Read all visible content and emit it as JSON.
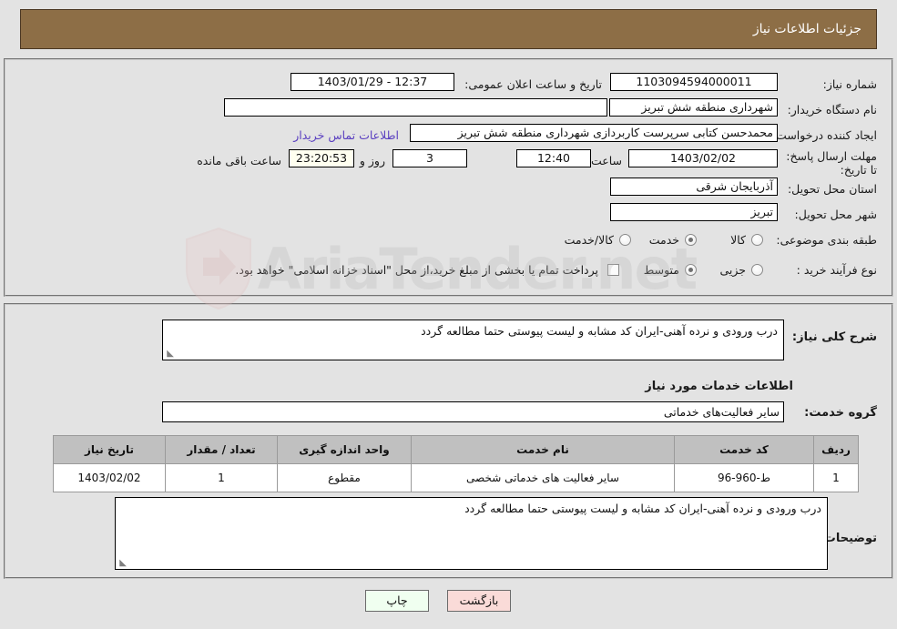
{
  "header": {
    "title": "جزئیات اطلاعات نیاز"
  },
  "form": {
    "need_number_label": "شماره نیاز:",
    "need_number_value": "1103094594000011",
    "announce_datetime_label": "تاریخ و ساعت اعلان عمومی:",
    "announce_datetime_value": "12:37 - 1403/01/29",
    "buyer_org_label": "نام دستگاه خریدار:",
    "buyer_org_value": "شهرداری منطقه شش تبریز",
    "buyer_org_value2": "",
    "requester_label": "ایجاد کننده درخواست:",
    "requester_value": "محمدحسن کتابی سرپرست کاربردازی شهرداری منطقه شش تبریز",
    "contact_link": "اطلاعات تماس خریدار",
    "deadline_label": "مهلت ارسال پاسخ: تا تاریخ:",
    "deadline_date": "1403/02/02",
    "hour_label": "ساعت",
    "deadline_time": "12:40",
    "days_remaining": "3",
    "days_label": "روز و",
    "countdown": "23:20:53",
    "remaining_label": "ساعت باقی مانده",
    "province_label": "استان محل تحویل:",
    "province_value": "آذربایجان شرقی",
    "city_label": "شهر محل تحویل:",
    "city_value": "تبریز",
    "category_label": "طبقه بندی موضوعی:",
    "category_options": [
      {
        "label": "کالا",
        "selected": false
      },
      {
        "label": "خدمت",
        "selected": true
      },
      {
        "label": "کالا/خدمت",
        "selected": false
      }
    ],
    "process_label": "نوع فرآیند خرید :",
    "process_options": [
      {
        "label": "جزیی",
        "selected": false
      },
      {
        "label": "متوسط",
        "selected": true
      }
    ],
    "treasury_checkbox_label": "پرداخت تمام یا بخشی از مبلغ خرید،از محل \"اسناد خزانه اسلامی\" خواهد بود.",
    "treasury_checked": false
  },
  "detail": {
    "general_desc_label": "شرح کلی نیاز:",
    "general_desc_value": "درب ورودی و نرده آهنی-ایران کد مشابه و لیست پیوستی حتما مطالعه گردد",
    "services_info_title": "اطلاعات خدمات مورد نیاز",
    "service_group_label": "گروه خدمت:",
    "service_group_value": "سایر فعالیت‌های خدماتی",
    "table": {
      "headers": [
        "ردیف",
        "کد خدمت",
        "نام خدمت",
        "واحد اندازه گیری",
        "تعداد / مقدار",
        "تاریخ نیاز"
      ],
      "rows": [
        [
          "1",
          "ط-960-96",
          "سایر فعالیت های خدماتی شخصی",
          "مقطوع",
          "1",
          "1403/02/02"
        ]
      ]
    },
    "buyer_notes_label": "توضیحات خریدار:",
    "buyer_notes_value": "درب ورودی و نرده آهنی-ایران کد مشابه و لیست پیوستی حتما مطالعه گردد"
  },
  "footer": {
    "print_label": "چاپ",
    "back_label": "بازگشت"
  },
  "watermark": {
    "text": "AriaTender.net"
  },
  "colors": {
    "header_bg": "#8d6e46",
    "page_bg": "#e3e3e3",
    "link": "#5a3fc0",
    "timer_bg": "#fffff0",
    "back_btn_bg": "#fadbd8",
    "print_btn_bg": "#f0fff0",
    "table_header_bg": "#c0c0c0"
  }
}
